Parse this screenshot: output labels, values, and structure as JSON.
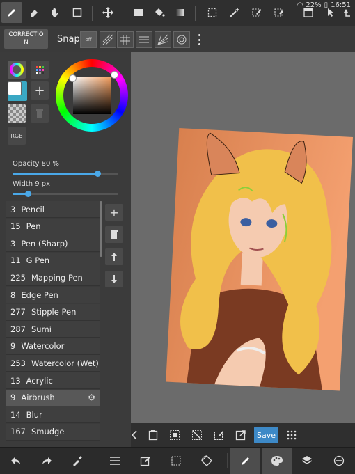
{
  "status": {
    "battery": "22%",
    "time": "16:51"
  },
  "snap": {
    "correction_label": "CORRECTIO",
    "correction_label2": "N",
    "snap_label": "Snap",
    "off_label": "off"
  },
  "color": {
    "rgb_label": "RGB",
    "accent": "#4aa8e8"
  },
  "sliders": {
    "opacity_label": "Opacity 80 %",
    "opacity_value": 80,
    "width_label": "Width 9 px"
  },
  "brushes": [
    {
      "size": "3",
      "name": "Pencil"
    },
    {
      "size": "15",
      "name": "Pen"
    },
    {
      "size": "3",
      "name": "Pen (Sharp)"
    },
    {
      "size": "11",
      "name": "G Pen"
    },
    {
      "size": "225",
      "name": "Mapping Pen"
    },
    {
      "size": "8",
      "name": "Edge Pen"
    },
    {
      "size": "277",
      "name": "Stipple Pen"
    },
    {
      "size": "287",
      "name": "Sumi"
    },
    {
      "size": "9",
      "name": "Watercolor"
    },
    {
      "size": "253",
      "name": "Watercolor (Wet)"
    },
    {
      "size": "13",
      "name": "Acrylic"
    },
    {
      "size": "9",
      "name": "Airbrush"
    },
    {
      "size": "14",
      "name": "Blur"
    },
    {
      "size": "167",
      "name": "Smudge"
    }
  ],
  "canvasbar": {
    "save_label": "Save"
  }
}
